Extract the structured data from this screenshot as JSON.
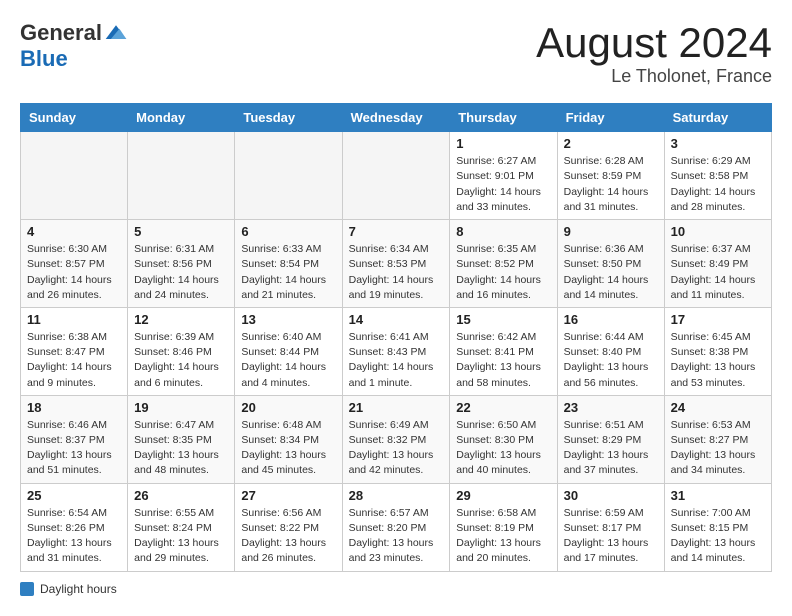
{
  "logo": {
    "general": "General",
    "blue": "Blue"
  },
  "title": {
    "month_year": "August 2024",
    "location": "Le Tholonet, France"
  },
  "weekdays": [
    "Sunday",
    "Monday",
    "Tuesday",
    "Wednesday",
    "Thursday",
    "Friday",
    "Saturday"
  ],
  "weeks": [
    [
      {
        "day": "",
        "info": ""
      },
      {
        "day": "",
        "info": ""
      },
      {
        "day": "",
        "info": ""
      },
      {
        "day": "",
        "info": ""
      },
      {
        "day": "1",
        "info": "Sunrise: 6:27 AM\nSunset: 9:01 PM\nDaylight: 14 hours and 33 minutes."
      },
      {
        "day": "2",
        "info": "Sunrise: 6:28 AM\nSunset: 8:59 PM\nDaylight: 14 hours and 31 minutes."
      },
      {
        "day": "3",
        "info": "Sunrise: 6:29 AM\nSunset: 8:58 PM\nDaylight: 14 hours and 28 minutes."
      }
    ],
    [
      {
        "day": "4",
        "info": "Sunrise: 6:30 AM\nSunset: 8:57 PM\nDaylight: 14 hours and 26 minutes."
      },
      {
        "day": "5",
        "info": "Sunrise: 6:31 AM\nSunset: 8:56 PM\nDaylight: 14 hours and 24 minutes."
      },
      {
        "day": "6",
        "info": "Sunrise: 6:33 AM\nSunset: 8:54 PM\nDaylight: 14 hours and 21 minutes."
      },
      {
        "day": "7",
        "info": "Sunrise: 6:34 AM\nSunset: 8:53 PM\nDaylight: 14 hours and 19 minutes."
      },
      {
        "day": "8",
        "info": "Sunrise: 6:35 AM\nSunset: 8:52 PM\nDaylight: 14 hours and 16 minutes."
      },
      {
        "day": "9",
        "info": "Sunrise: 6:36 AM\nSunset: 8:50 PM\nDaylight: 14 hours and 14 minutes."
      },
      {
        "day": "10",
        "info": "Sunrise: 6:37 AM\nSunset: 8:49 PM\nDaylight: 14 hours and 11 minutes."
      }
    ],
    [
      {
        "day": "11",
        "info": "Sunrise: 6:38 AM\nSunset: 8:47 PM\nDaylight: 14 hours and 9 minutes."
      },
      {
        "day": "12",
        "info": "Sunrise: 6:39 AM\nSunset: 8:46 PM\nDaylight: 14 hours and 6 minutes."
      },
      {
        "day": "13",
        "info": "Sunrise: 6:40 AM\nSunset: 8:44 PM\nDaylight: 14 hours and 4 minutes."
      },
      {
        "day": "14",
        "info": "Sunrise: 6:41 AM\nSunset: 8:43 PM\nDaylight: 14 hours and 1 minute."
      },
      {
        "day": "15",
        "info": "Sunrise: 6:42 AM\nSunset: 8:41 PM\nDaylight: 13 hours and 58 minutes."
      },
      {
        "day": "16",
        "info": "Sunrise: 6:44 AM\nSunset: 8:40 PM\nDaylight: 13 hours and 56 minutes."
      },
      {
        "day": "17",
        "info": "Sunrise: 6:45 AM\nSunset: 8:38 PM\nDaylight: 13 hours and 53 minutes."
      }
    ],
    [
      {
        "day": "18",
        "info": "Sunrise: 6:46 AM\nSunset: 8:37 PM\nDaylight: 13 hours and 51 minutes."
      },
      {
        "day": "19",
        "info": "Sunrise: 6:47 AM\nSunset: 8:35 PM\nDaylight: 13 hours and 48 minutes."
      },
      {
        "day": "20",
        "info": "Sunrise: 6:48 AM\nSunset: 8:34 PM\nDaylight: 13 hours and 45 minutes."
      },
      {
        "day": "21",
        "info": "Sunrise: 6:49 AM\nSunset: 8:32 PM\nDaylight: 13 hours and 42 minutes."
      },
      {
        "day": "22",
        "info": "Sunrise: 6:50 AM\nSunset: 8:30 PM\nDaylight: 13 hours and 40 minutes."
      },
      {
        "day": "23",
        "info": "Sunrise: 6:51 AM\nSunset: 8:29 PM\nDaylight: 13 hours and 37 minutes."
      },
      {
        "day": "24",
        "info": "Sunrise: 6:53 AM\nSunset: 8:27 PM\nDaylight: 13 hours and 34 minutes."
      }
    ],
    [
      {
        "day": "25",
        "info": "Sunrise: 6:54 AM\nSunset: 8:26 PM\nDaylight: 13 hours and 31 minutes."
      },
      {
        "day": "26",
        "info": "Sunrise: 6:55 AM\nSunset: 8:24 PM\nDaylight: 13 hours and 29 minutes."
      },
      {
        "day": "27",
        "info": "Sunrise: 6:56 AM\nSunset: 8:22 PM\nDaylight: 13 hours and 26 minutes."
      },
      {
        "day": "28",
        "info": "Sunrise: 6:57 AM\nSunset: 8:20 PM\nDaylight: 13 hours and 23 minutes."
      },
      {
        "day": "29",
        "info": "Sunrise: 6:58 AM\nSunset: 8:19 PM\nDaylight: 13 hours and 20 minutes."
      },
      {
        "day": "30",
        "info": "Sunrise: 6:59 AM\nSunset: 8:17 PM\nDaylight: 13 hours and 17 minutes."
      },
      {
        "day": "31",
        "info": "Sunrise: 7:00 AM\nSunset: 8:15 PM\nDaylight: 13 hours and 14 minutes."
      }
    ]
  ],
  "legend": {
    "label": "Daylight hours"
  }
}
